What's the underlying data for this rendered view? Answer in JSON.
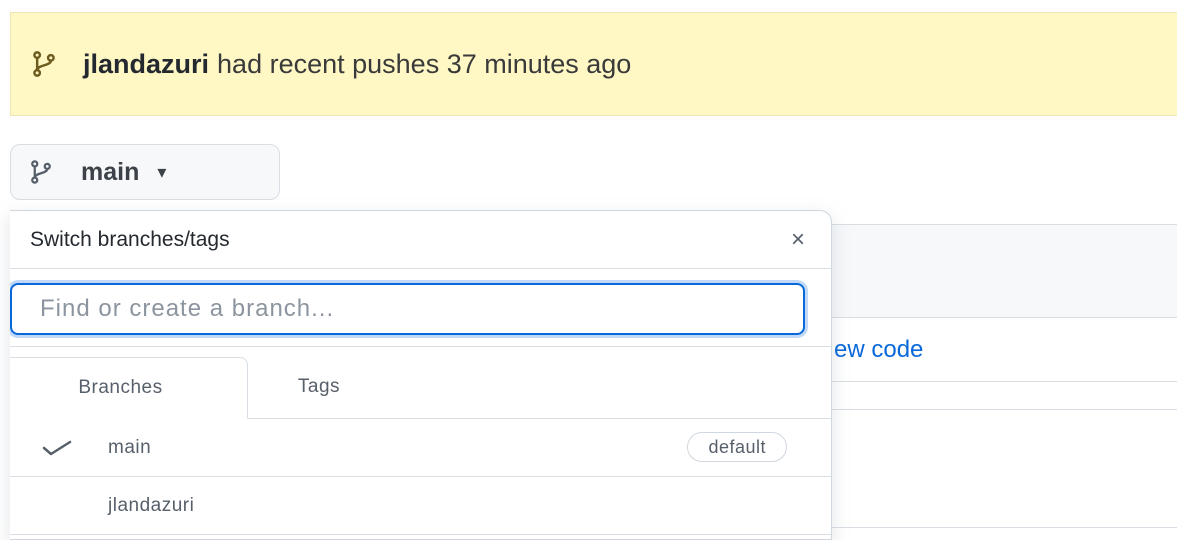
{
  "banner": {
    "icon": "git-branch-icon",
    "user": "jlandazuri",
    "message": "had recent pushes 37 minutes ago",
    "background_color": "#fff8c5"
  },
  "branch_button": {
    "icon": "git-branch-icon",
    "label": "main",
    "caret": "▾"
  },
  "background": {
    "view_code_fragment": "ew code"
  },
  "dropdown": {
    "title": "Switch branches/tags",
    "close_icon": "×",
    "search": {
      "placeholder": "Find or create a branch...",
      "value": ""
    },
    "tabs": [
      {
        "label": "Branches",
        "active": true
      },
      {
        "label": "Tags",
        "active": false
      }
    ],
    "items": [
      {
        "name": "main",
        "checked": true,
        "badge": "default"
      },
      {
        "name": "jlandazuri",
        "checked": false,
        "badge": ""
      }
    ],
    "accent_color": "#0969da"
  }
}
